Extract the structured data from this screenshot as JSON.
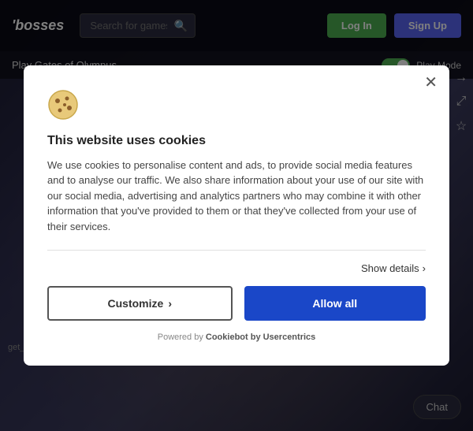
{
  "header": {
    "logo_text": "bosses",
    "logo_prefix": "'",
    "search_placeholder": "Search for games",
    "login_label": "Log In",
    "signup_label": "Sign Up"
  },
  "sub_header": {
    "play_title": "Play Gates of Olympus",
    "play_mode_label": "Play Mode"
  },
  "sidebar_icons": {
    "arrow_right": "→",
    "expand": "⤢",
    "star": "☆",
    "close": "✕"
  },
  "cookie_modal": {
    "title": "This website uses cookies",
    "body_text": "We use cookies to personalise content and ads, to provide social media features and to analyse our traffic. We also share information about your use of our site with our social media, advertising and analytics partners who may combine it with other information that you've provided to them or that they've collected from your use of their services.",
    "show_details_label": "Show details",
    "customize_label": "Customize",
    "allow_all_label": "Allow all",
    "powered_by_text": "Powered by",
    "powered_by_link": "Cookiebot by Usercentrics",
    "close_label": "✕"
  },
  "footer": {
    "error_text": "get_game_link_system_error",
    "chat_label": "Chat"
  }
}
